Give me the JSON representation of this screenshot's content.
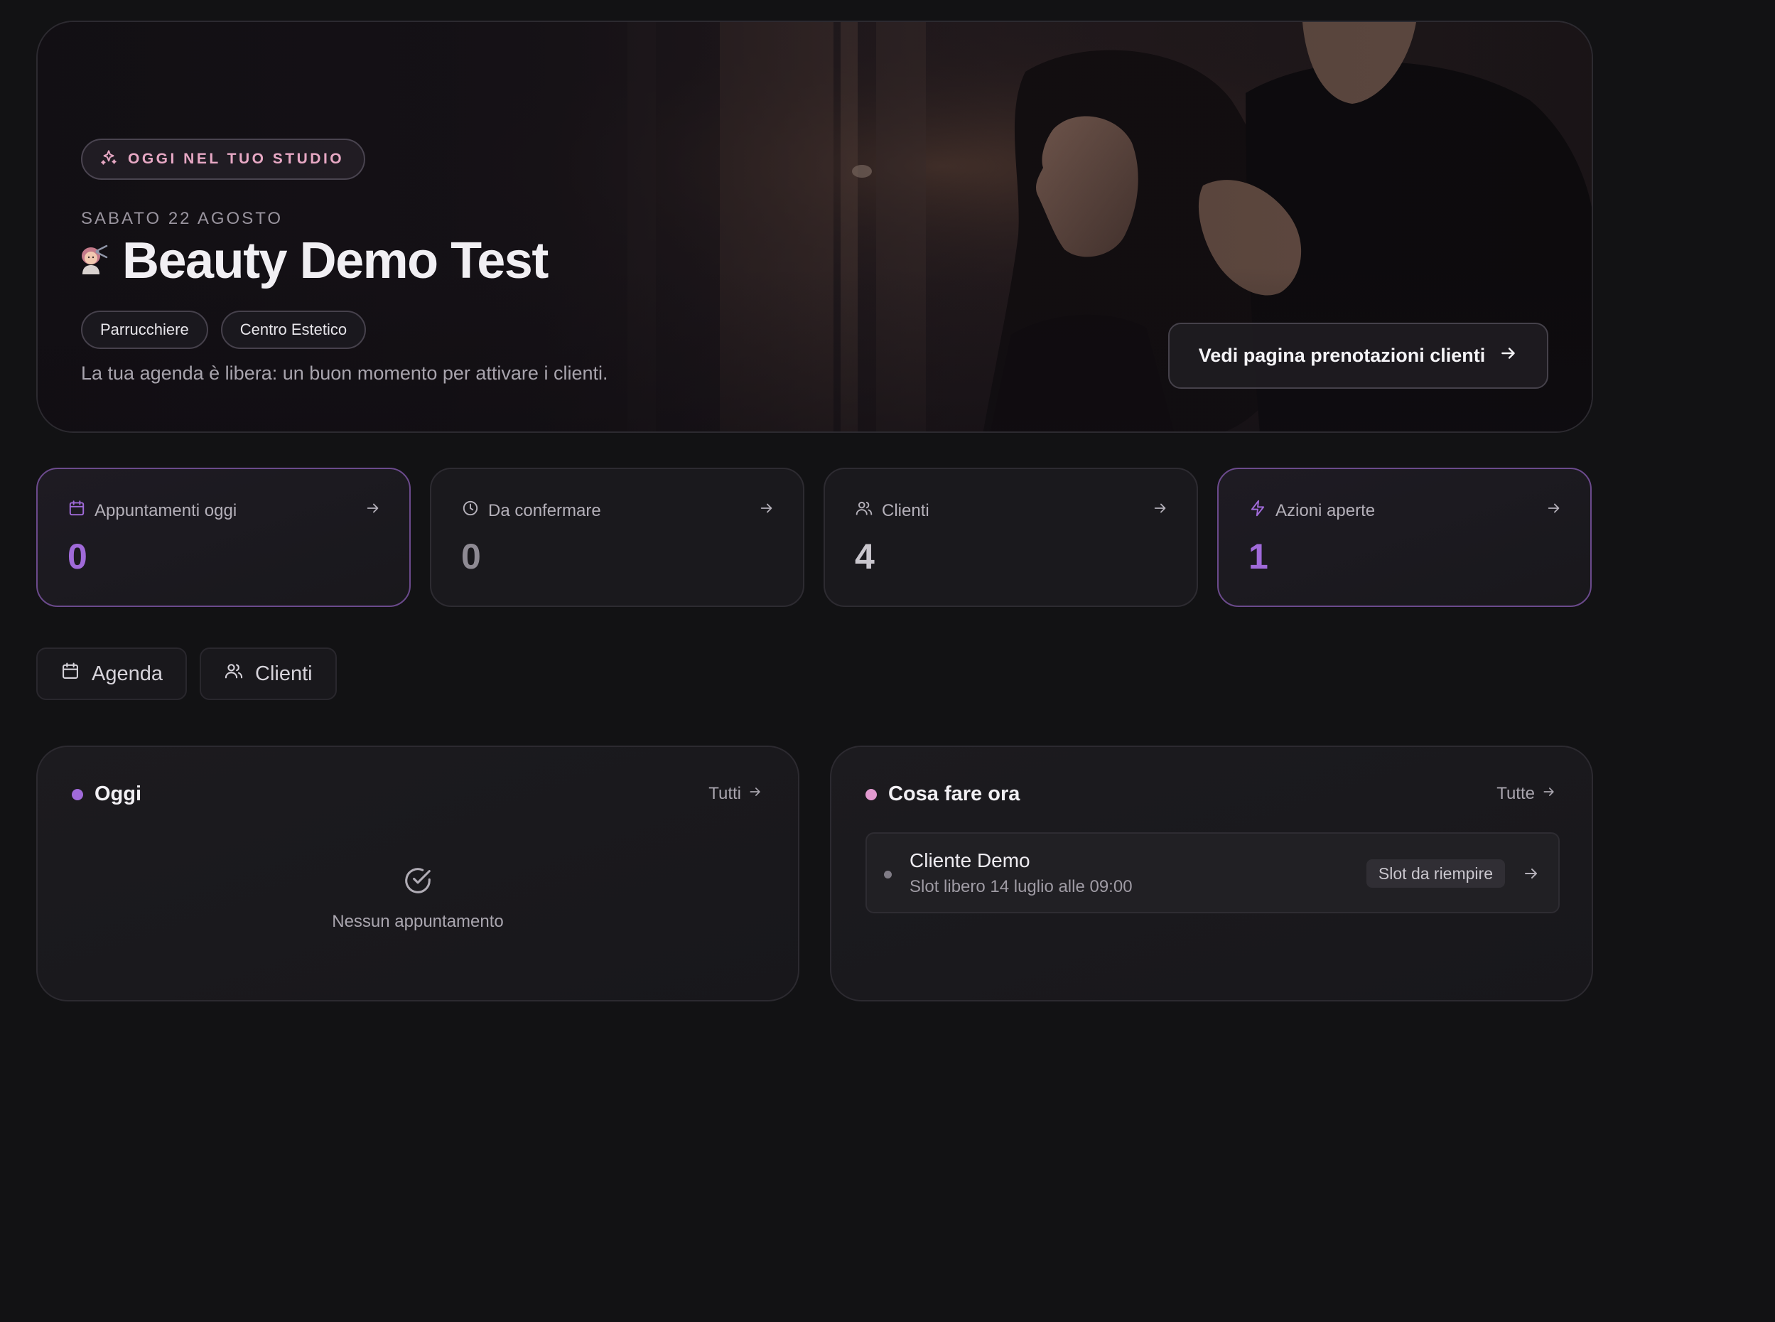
{
  "hero": {
    "badge": "OGGI NEL TUO STUDIO",
    "date": "SABATO 22 AGOSTO",
    "title": "Beauty Demo Test",
    "tags": [
      "Parrucchiere",
      "Centro Estetico"
    ],
    "description": "La tua agenda è libera: un buon momento per attivare i clienti.",
    "cta": "Vedi pagina prenotazioni clienti"
  },
  "stats": [
    {
      "label": "Appuntamenti oggi",
      "value": "0",
      "icon": "calendar-icon"
    },
    {
      "label": "Da confermare",
      "value": "0",
      "icon": "clock-icon"
    },
    {
      "label": "Clienti",
      "value": "4",
      "icon": "users-icon"
    },
    {
      "label": "Azioni aperte",
      "value": "1",
      "icon": "lightning-icon"
    }
  ],
  "quick_links": [
    {
      "label": "Agenda",
      "icon": "calendar-icon"
    },
    {
      "label": "Clienti",
      "icon": "users-icon"
    }
  ],
  "today_panel": {
    "title": "Oggi",
    "link": "Tutti",
    "empty_text": "Nessun appuntamento"
  },
  "todo_panel": {
    "title": "Cosa fare ora",
    "link": "Tutte",
    "items": [
      {
        "name": "Cliente Demo",
        "subtitle": "Slot libero 14 luglio alle 09:00",
        "badge": "Slot da riempire"
      }
    ]
  },
  "colors": {
    "background": "#121214",
    "accent_purple": "#a06ad9",
    "accent_pink": "#e7a8c4",
    "card": "#1a191d"
  }
}
